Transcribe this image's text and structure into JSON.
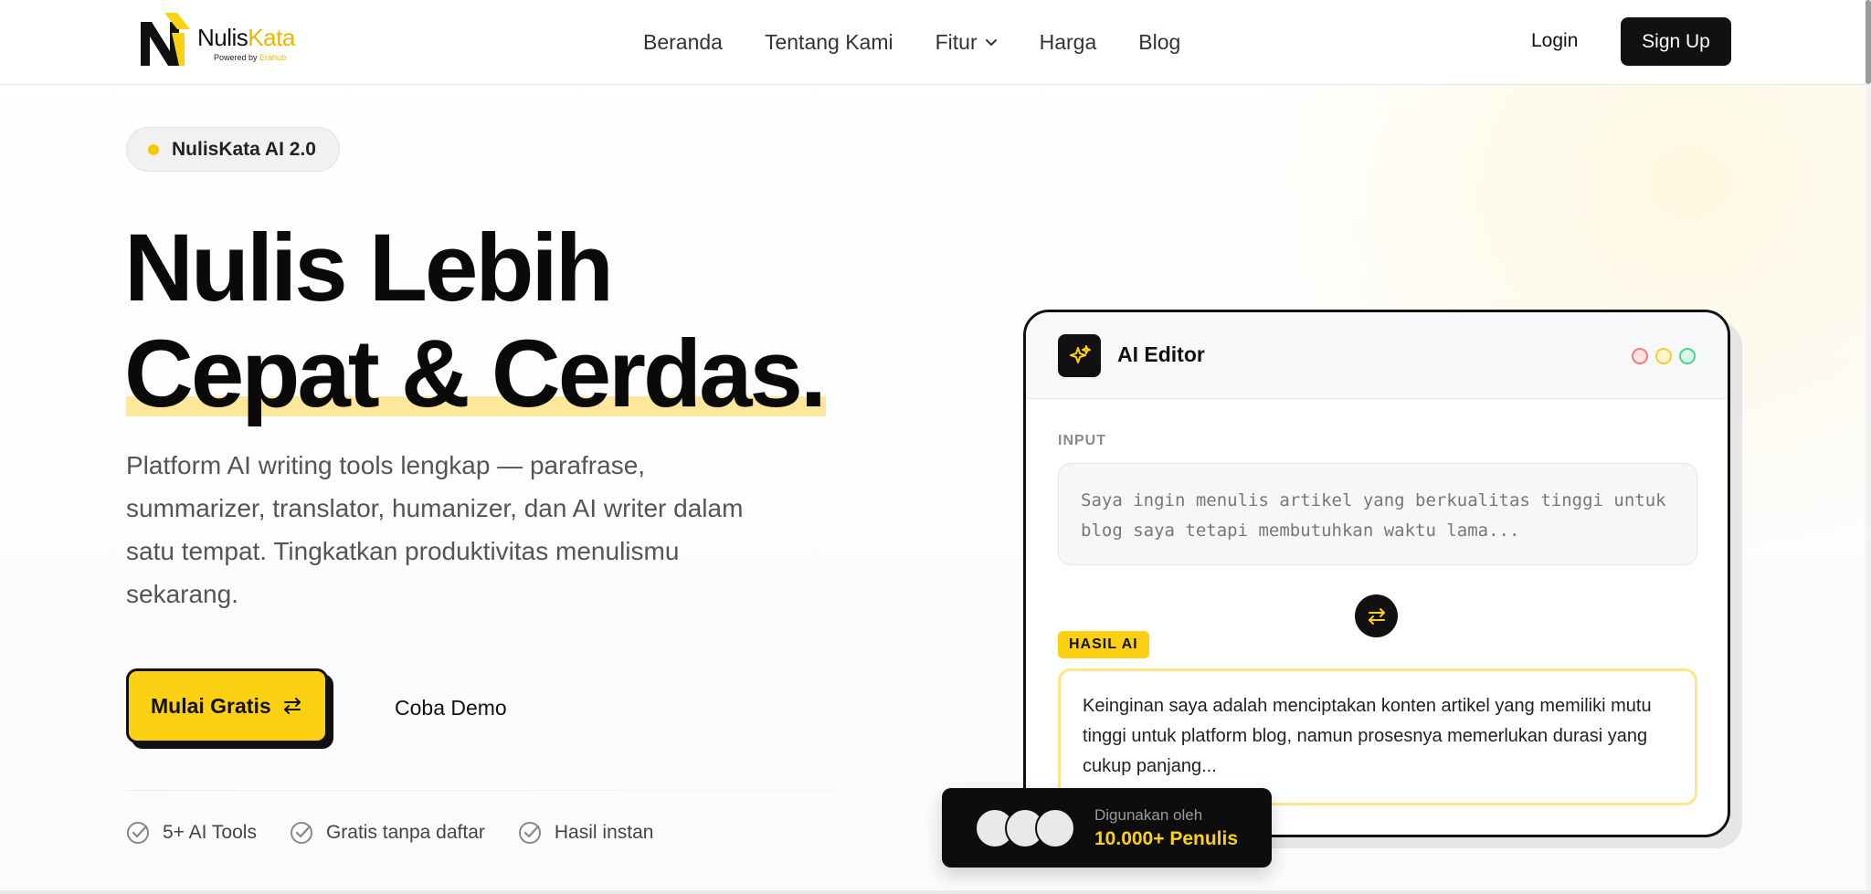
{
  "brand": {
    "name_part1": "Nulis",
    "name_part2": "Kata",
    "powered_prefix": "Powered by",
    "powered_brand": "Erahub",
    "accent_color": "#fcd114"
  },
  "nav": {
    "links": [
      "Beranda",
      "Tentang Kami",
      "Fitur",
      "Harga",
      "Blog"
    ],
    "login_label": "Login",
    "signup_label": "Sign Up"
  },
  "hero": {
    "badge": "NulisKata AI 2.0",
    "title_line1": "Nulis Lebih",
    "title_line2": "Cepat & Cerdas.",
    "description": "Platform AI writing tools lengkap — parafrase, summarizer, translator, humanizer, dan AI writer dalam satu tempat. Tingkatkan produktivitas menulismu sekarang.",
    "cta_primary": "Mulai Gratis",
    "cta_secondary": "Coba Demo",
    "features": [
      "5+ AI Tools",
      "Gratis tanpa daftar",
      "Hasil instan"
    ]
  },
  "editor": {
    "title": "AI Editor",
    "input_label": "INPUT",
    "input_text": "Saya ingin menulis artikel yang berkualitas tinggi untuk blog saya tetapi membutuhkan waktu lama...",
    "result_label": "HASIL AI",
    "result_text": "Keinginan saya adalah menciptakan konten artikel yang memiliki mutu tinggi untuk platform blog, namun prosesnya memerlukan durasi yang cukup panjang..."
  },
  "users": {
    "label": "Digunakan oleh",
    "count": "10.000+ Penulis"
  },
  "icons": {
    "fitur_dropdown": "chevron-down-icon",
    "cta": "swap-icon",
    "editor": "sparkles-icon",
    "feature_check": "check-circle-icon"
  }
}
